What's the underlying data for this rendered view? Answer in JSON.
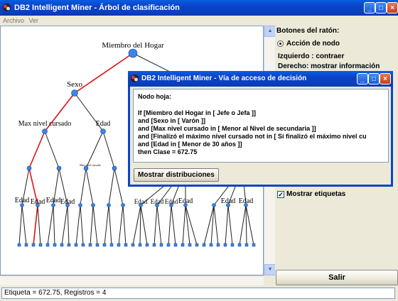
{
  "window": {
    "title": "DB2 Intelligent Miner - Árbol de clasificación"
  },
  "menu": [
    "Archivo",
    "Ver"
  ],
  "tree": {
    "root_label": "Miembro del Hogar",
    "level1_label": "Sexo",
    "level2_left_label": "Max nivel cursado",
    "level2_right_label": "Edad",
    "level3_small_label": "Max nivel cursado",
    "leaf_labels": [
      "Edad",
      "Edad",
      "Edad",
      "Edad",
      "Edad",
      "Edad",
      "Edad",
      "Edad",
      "Edad",
      "Edad"
    ]
  },
  "panel": {
    "mouse_buttons_heading": "Botones del ratón:",
    "node_action_option": "Acción de nodo",
    "left_action": "Izquierdo : contraer",
    "right_action": "Derecho: mostrar información",
    "show_labels": "Mostrar etiquetas",
    "exit_button": "Salir"
  },
  "status": {
    "text": "Etiqueta = 672.75, Registros = 4"
  },
  "dialog": {
    "title": "DB2 Intelligent Miner - Vía de acceso de decisión",
    "heading": "Nodo hoja:",
    "lines": [
      "If [Miembro del Hogar in [ Jefe o Jefa ]]",
      "and [Sexo in [ Varón ]]",
      "and [Max nivel cursado in [ Menor al Nivel de secundaria ]]",
      "and [Finalizó el máximo nivel cursado not in [ Sí finalizó el máximo nivel cu",
      "and [Edad in [ Menor de 30 años ]]",
      "then Clase = 672.75"
    ],
    "button": "Mostrar distribuciones"
  },
  "colors": {
    "path_highlight": "#e01010",
    "node_fill": "#3a86e8",
    "edge": "#202020",
    "titlebar": "#0a4fd8"
  }
}
